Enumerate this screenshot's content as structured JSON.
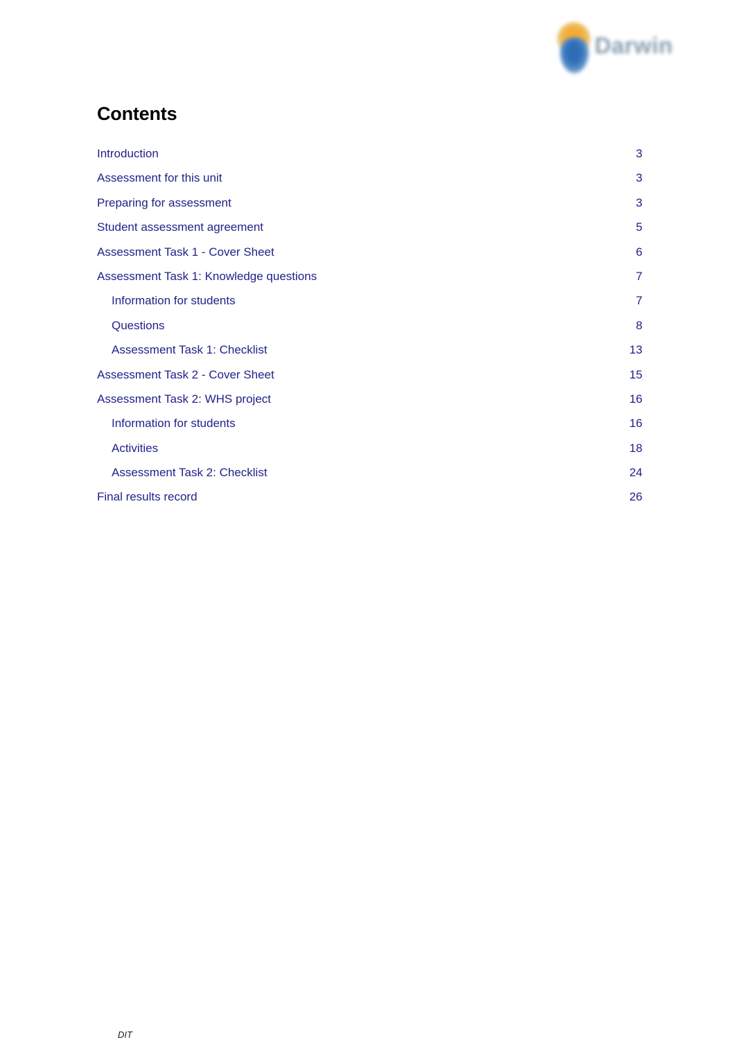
{
  "header": {
    "logo": {
      "mark_name": "sun-shield-logo-mark",
      "wordmark": "Darwin",
      "sun_color": "#f3a21f",
      "shield_color": "#1f63b2",
      "wordmark_color": "#7d96a8"
    }
  },
  "document": {
    "heading": "Contents",
    "heading_color": "#000000",
    "link_color": "#21218a"
  },
  "toc": {
    "entries": [
      {
        "label": "Introduction",
        "page": "3",
        "level": 1
      },
      {
        "label": "Assessment for this unit",
        "page": "3",
        "level": 1
      },
      {
        "label": "Preparing for assessment",
        "page": "3",
        "level": 1
      },
      {
        "label": "Student assessment agreement",
        "page": "5",
        "level": 1
      },
      {
        "label": "Assessment Task 1 - Cover Sheet",
        "page": "6",
        "level": 1
      },
      {
        "label": "Assessment Task 1: Knowledge questions",
        "page": "7",
        "level": 1
      },
      {
        "label": "Information for students",
        "page": "7",
        "level": 2
      },
      {
        "label": "Questions",
        "page": "8",
        "level": 2
      },
      {
        "label": "Assessment Task 1: Checklist",
        "page": "13",
        "level": 2
      },
      {
        "label": "Assessment Task 2 - Cover Sheet",
        "page": "15",
        "level": 1
      },
      {
        "label": "Assessment Task 2: WHS project",
        "page": "16",
        "level": 1
      },
      {
        "label": "Information for students",
        "page": "16",
        "level": 2
      },
      {
        "label": "Activities",
        "page": "18",
        "level": 2
      },
      {
        "label": "Assessment Task 2: Checklist",
        "page": "24",
        "level": 2
      },
      {
        "label": "Final results record",
        "page": "26",
        "level": 1
      }
    ]
  },
  "footer": {
    "text": "DIT"
  }
}
